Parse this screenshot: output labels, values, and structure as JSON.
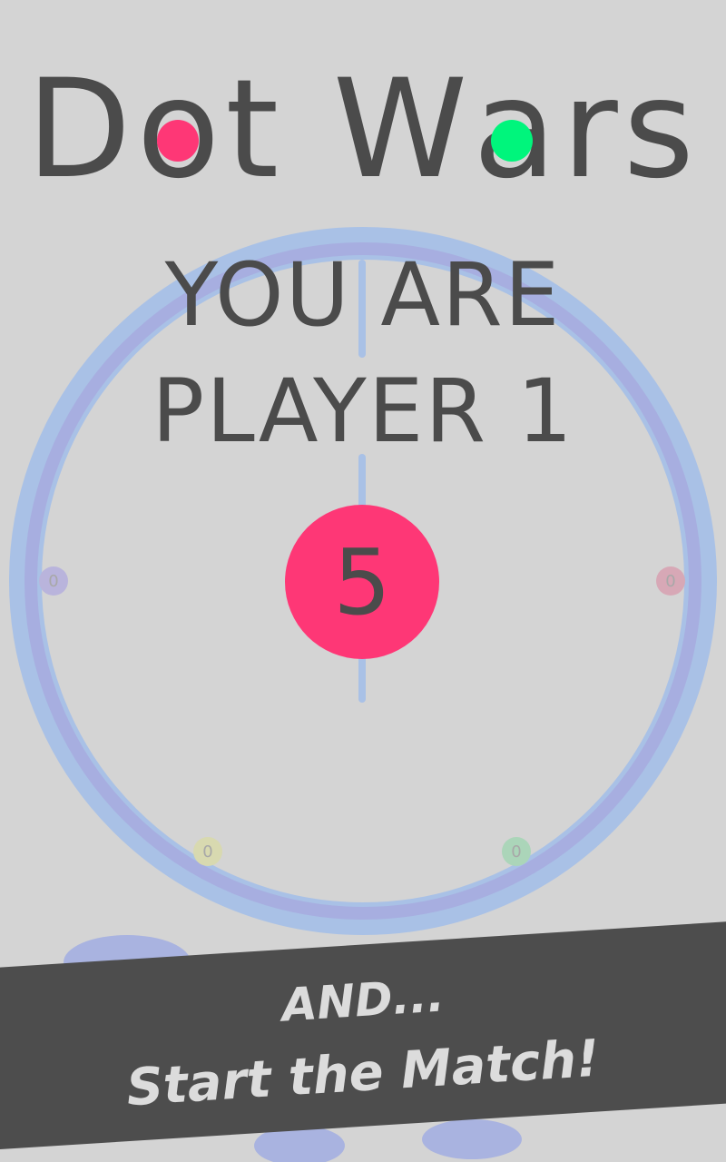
{
  "title": {
    "text_before": "D",
    "text_o1": "o",
    "text_after_o1": "t W",
    "text_a": "a",
    "text_after_a": "rs"
  },
  "message": {
    "line1": "YOU ARE",
    "line2": "PLAYER 1"
  },
  "countdown": "5",
  "players": [
    {
      "score": "0",
      "color": "#9c95d6"
    },
    {
      "score": "0",
      "color": "#e07a9a"
    },
    {
      "score": "0",
      "color": "#d6d98a"
    },
    {
      "score": "0",
      "color": "#7fd4a3"
    }
  ],
  "banner": {
    "line1": "AND...",
    "line2": "Start the Match!"
  },
  "colors": {
    "background": "#d4d4d4",
    "player1": "#fe3776",
    "player2": "#00f57c",
    "text": "#4b4b4b",
    "ring_outer": "#a9c1e6",
    "ring_inner": "#a7aee0",
    "banner": "#4d4d4d"
  }
}
